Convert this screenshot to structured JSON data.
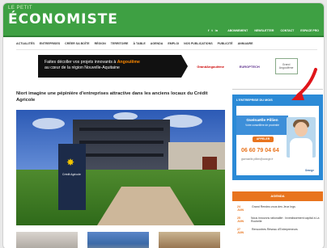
{
  "site": {
    "logo_small": "LE PETIT",
    "logo_big": "ÉCONOMISTE",
    "top_links": [
      "ABONNEMENT",
      "NEWSLETTER",
      "CONTACT",
      "ESPACE PRO"
    ],
    "social": [
      "f",
      "t",
      "in"
    ]
  },
  "nav": {
    "items": [
      "ACTUALITÉS",
      "ENTREPRISES",
      "CRÉER SA BOÎTE",
      "RÉGION",
      "TERRITOIRE",
      "À TABLE",
      "AGENDA",
      "EMPLOI",
      "NOS PUBLICATIONS",
      "PUBLICITÉ",
      "ANNUAIRE"
    ]
  },
  "banner": {
    "text_before": "Faites décoller vos projets innovants à ",
    "highlight": "Angoulême",
    "text_after": "au cœur de la région Nouvelle-Aquitaine",
    "logo1": "GrandAngoulême",
    "logo2": "EUROPTECH",
    "logo3": "Grand Angoulême"
  },
  "article": {
    "title": "Niort imagine une pépinière d'entreprises attractive dans les anciens locaux du Crédit Agricole",
    "sign_text": "Crédit Agricole"
  },
  "sidebar_ad": {
    "header": "L'ENTREPRISE DU MOIS",
    "name": "Gwénaëlle Pillien",
    "subtitle": "Votre conseillère de proximité",
    "button": "APPELER",
    "phone": "06 60 79 04 64",
    "footer": "gwenaelle.pillien@orange.fr",
    "brand": "Orange"
  },
  "agenda": {
    "header": "AGENDA",
    "items": [
      {
        "date": "24 JUIN",
        "text": "Grand Rendez-vous des Jeux Ings"
      },
      {
        "date": "25 JUIN",
        "text": "Nous innovons rationalité : Investissement capital à La Rochelle"
      },
      {
        "date": "27 JUIN",
        "text": "Rencontres Réseau d'Entrepreneurs"
      }
    ]
  },
  "colors": {
    "header_green": "#3ea043",
    "accent_orange": "#e8741e",
    "ad_blue": "#2b8ad6",
    "annotation_red": "#e0151a"
  }
}
